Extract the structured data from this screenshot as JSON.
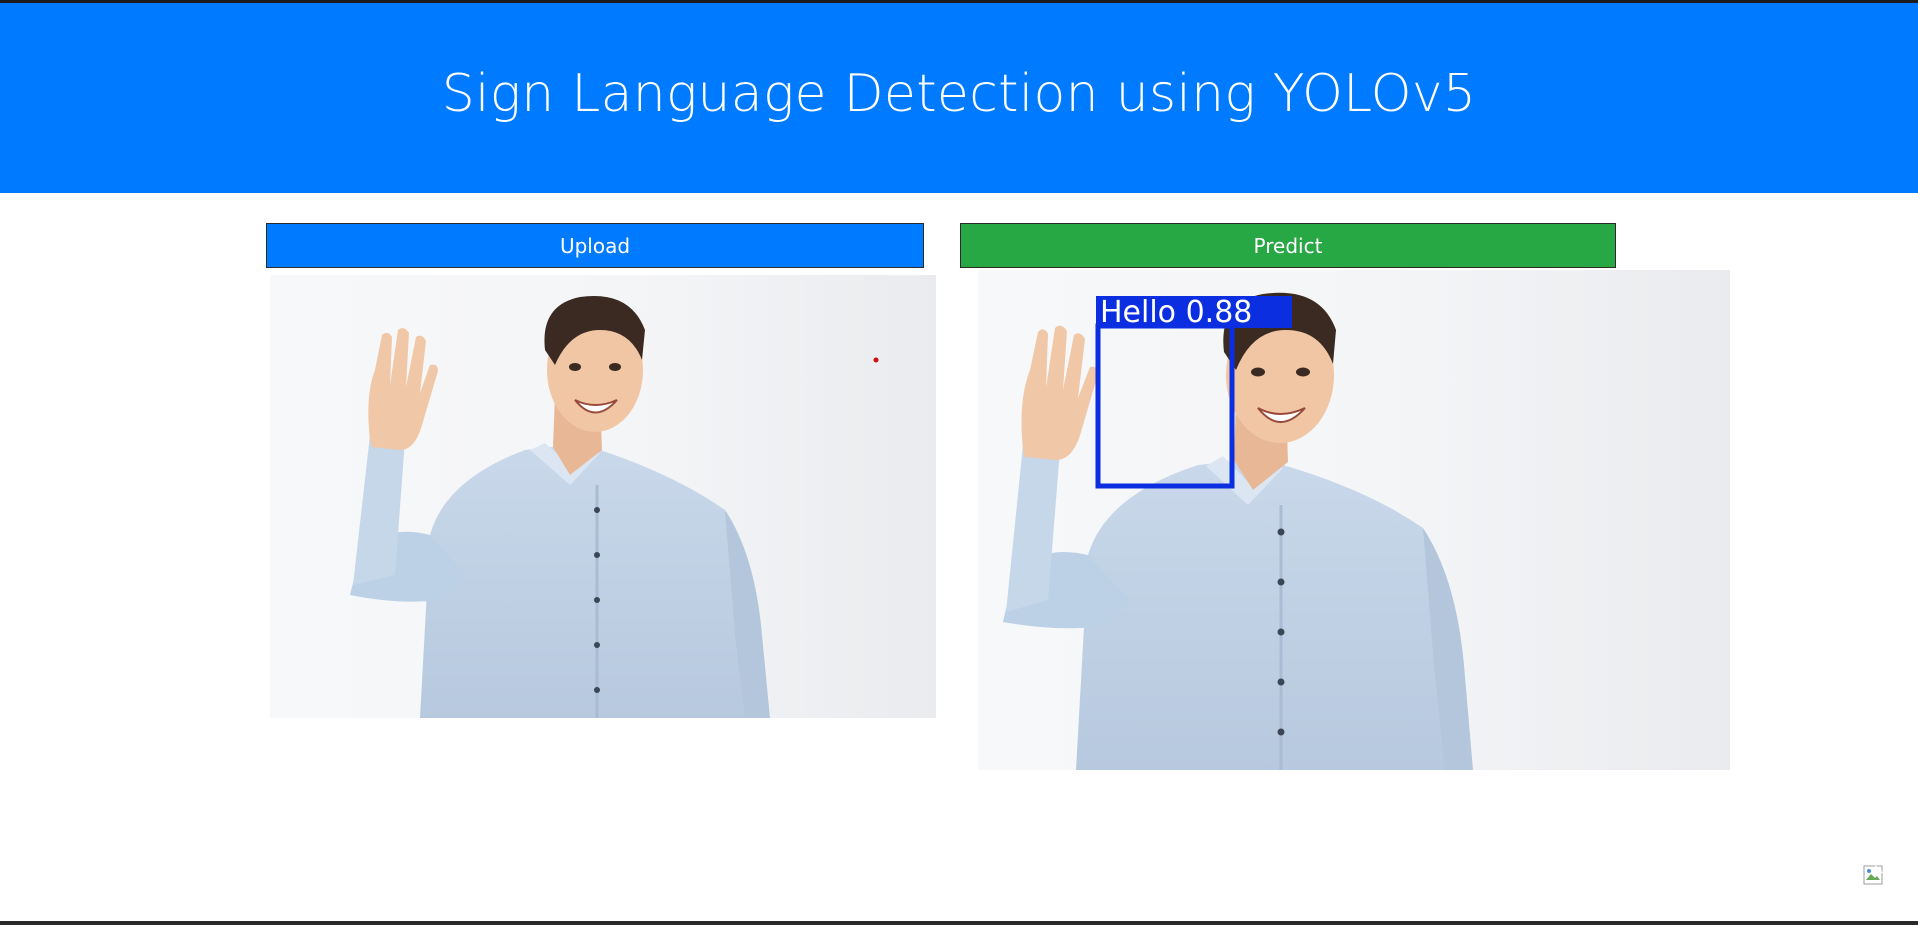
{
  "header": {
    "title": "Sign Language Detection using YOLOv5"
  },
  "actions": {
    "upload_label": "Upload",
    "predict_label": "Predict"
  },
  "detection": {
    "label": "Hello 0.88",
    "box_color": "#0a2ee0"
  },
  "colors": {
    "header_bg": "#007bff",
    "upload_bg": "#007bff",
    "predict_bg": "#28a745"
  },
  "icons": {
    "broken_image": "broken-image-icon"
  }
}
